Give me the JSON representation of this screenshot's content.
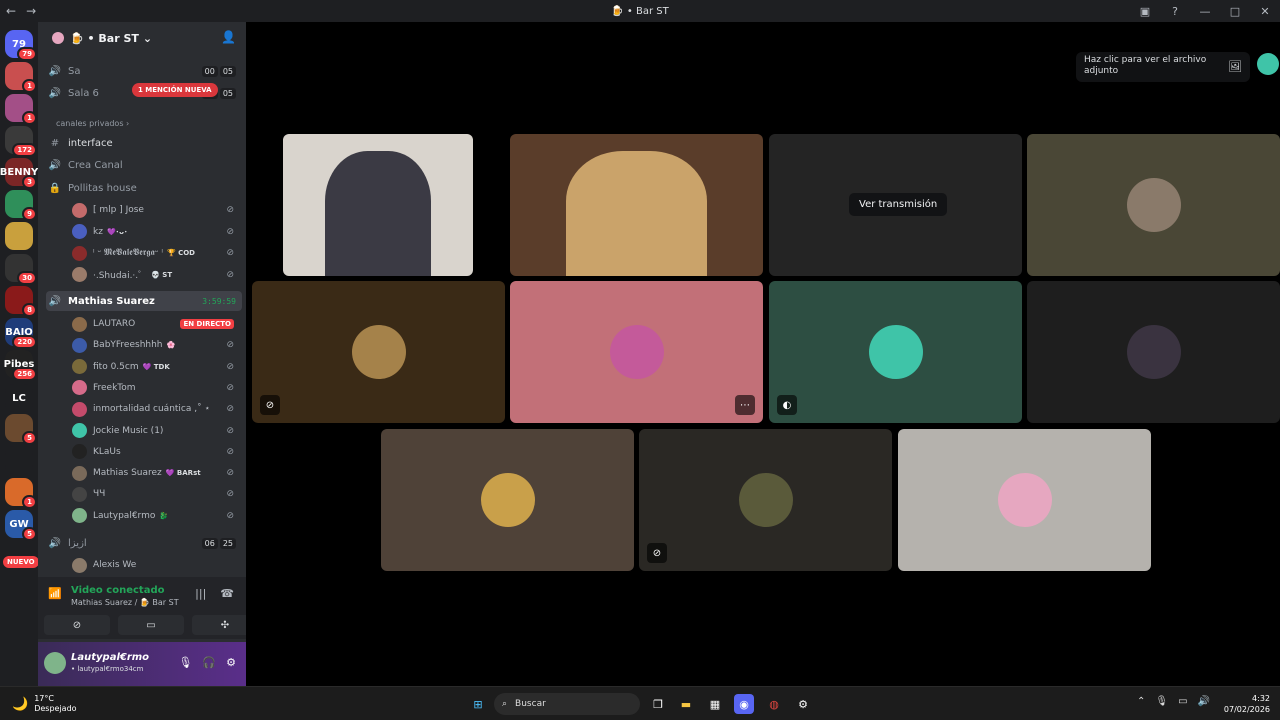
{
  "titlebar": {
    "title": "🍺 • Bar ST",
    "back": "←",
    "forward": "→"
  },
  "rail": {
    "servers": [
      {
        "label": "79",
        "badge": "79",
        "color": "#5865f2"
      },
      {
        "label": "",
        "badge": "1",
        "color": "#c94f4f"
      },
      {
        "label": "",
        "badge": "1",
        "color": "#a34f87"
      },
      {
        "label": "",
        "badge": "172",
        "color": "#3a3a3a"
      },
      {
        "label": "BENNY",
        "badge": "3",
        "color": "#7b2626"
      },
      {
        "label": "",
        "badge": "9",
        "color": "#2f8f5a"
      },
      {
        "label": "",
        "badge": "",
        "color": "#c9a03d"
      },
      {
        "label": "",
        "badge": "30",
        "color": "#333"
      },
      {
        "label": "",
        "badge": "8",
        "color": "#8a1a1a"
      },
      {
        "label": "BAJO",
        "badge": "220",
        "color": "#1f3c7a"
      },
      {
        "label": "Pibes",
        "badge": "256",
        "color": "#222"
      },
      {
        "label": "LC",
        "badge": "",
        "color": "#1e1f22"
      },
      {
        "label": "",
        "badge": "5",
        "color": "#6b4a2f"
      },
      {
        "label": "",
        "badge": "",
        "color": "#1e1f22"
      },
      {
        "label": "",
        "badge": "1",
        "color": "#d96a2a"
      },
      {
        "label": "GW",
        "badge": "5",
        "color": "#2a5aa8"
      }
    ],
    "new_label": "NUEVO"
  },
  "server_header": {
    "name": "🍺 • Bar ST",
    "chevron": "⌄"
  },
  "channels": {
    "mention_pill": "1 MENCIÓN NUEVA",
    "sala5": {
      "name": "Sa",
      "t1": "00",
      "t2": "05"
    },
    "sala6": {
      "name": "Sala 6",
      "t1": "00",
      "t2": "05"
    },
    "category": "canales privados",
    "interface": "interface",
    "crea_canal": "Crea Canal",
    "pollitas": "Pollitas house",
    "pollitas_users": [
      {
        "name": "[ mlp ] Jose",
        "tag": "",
        "color": "#c46b6b"
      },
      {
        "name": "kz",
        "tag": "💜･ᴗ･",
        "color": "#4a5fbf"
      },
      {
        "name": "ᵎ ᵕ 𝕸𝖊𝖁𝖆𝖑𝖊𝖁𝖊𝖗𝖌𝖆ᵕ ᵎ",
        "tag": "🏆 COD",
        "color": "#8a2b2b"
      },
      {
        "name": "·.Shudai.·.゜",
        "tag": "💀 ST",
        "color": "#9a7b6a"
      }
    ],
    "mathias_channel": {
      "name": "Mathias Suarez",
      "timer": "3:59:59"
    },
    "mathias_users": [
      {
        "name": "LAUTARO",
        "tag": "",
        "color": "#8a6a4a",
        "live": "EN DIRECTO"
      },
      {
        "name": "BabYFreeshhhh",
        "tag": "🌸",
        "color": "#3c5ba8"
      },
      {
        "name": "fito 0.5cm",
        "tag": "💜 TDK",
        "color": "#7a6a3a"
      },
      {
        "name": "FreekTom",
        "tag": "",
        "color": "#d66b8a"
      },
      {
        "name": "inmortalidad cuántica ,˚ ⋆",
        "tag": "",
        "color": "#c44b6b"
      },
      {
        "name": "Jockie Music (1)",
        "tag": "",
        "color": "#3fc4a8"
      },
      {
        "name": "KLaUs",
        "tag": "",
        "color": "#222"
      },
      {
        "name": "Mathias Suarez",
        "tag": "💜 BARst",
        "color": "#7a6a5a"
      },
      {
        "name": "ЧЧ",
        "tag": "",
        "color": "#444"
      },
      {
        "name": "Lautypal€rmo",
        "tag": "🐉",
        "color": "#7fb48a"
      }
    ],
    "last_channel": {
      "name": "ازيزا",
      "t1": "06",
      "t2": "25"
    },
    "last_user": {
      "name": "Alexis We",
      "color": "#8a7a6a"
    }
  },
  "voice_panel": {
    "status": "Video conectado",
    "location": "Mathias Suarez / 🍺 Bar ST"
  },
  "user_panel": {
    "name": "Lautypal€rmo",
    "tag": "• lautypal€rmo34cm"
  },
  "stage": {
    "attachment_hint": "Haz clic para ver el archivo adjunto",
    "watch_stream": "Ver transmisión",
    "tiles": [
      {
        "kind": "camera",
        "bg": "#d9d4cd",
        "avatar": ""
      },
      {
        "kind": "camera",
        "bg": "#5a3d2a",
        "avatar": ""
      },
      {
        "kind": "stream",
        "bg": "#242424",
        "avatar": ""
      },
      {
        "kind": "avatar",
        "bg": "#4a4736",
        "avatar": "#8a7a6a"
      },
      {
        "kind": "avatar",
        "bg": "#3a2a16",
        "avatar": "#a5824a"
      },
      {
        "kind": "avatar",
        "bg": "#c27078",
        "avatar": "#c45a9a"
      },
      {
        "kind": "avatar",
        "bg": "#2d4e42",
        "avatar": "#3fc4a8"
      },
      {
        "kind": "avatar",
        "bg": "#1e1e1e",
        "avatar": "#3a3340"
      },
      {
        "kind": "avatar",
        "bg": "#4f4238",
        "avatar": "#c9a04a"
      },
      {
        "kind": "avatar",
        "bg": "#2a2824",
        "avatar": "#5a5a3a"
      },
      {
        "kind": "avatar",
        "bg": "#b5b2ad",
        "avatar": "#e6a7c0"
      }
    ]
  },
  "taskbar": {
    "temp": "17°C",
    "weather": "Despejado",
    "search": "Buscar",
    "time": "4:32",
    "date": "07/02/2026"
  }
}
